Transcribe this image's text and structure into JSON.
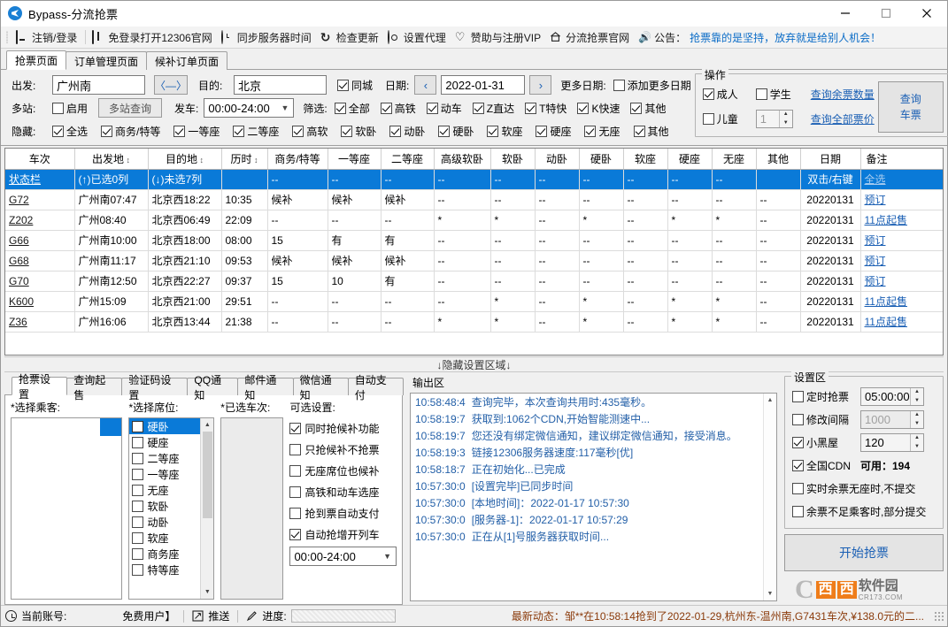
{
  "window": {
    "title": "Bypass-分流抢票",
    "minimize": "—",
    "maximize": "□",
    "close": "✕"
  },
  "toolbar": {
    "items": [
      {
        "icon": "monitor-icon",
        "label": "注销/登录"
      },
      {
        "icon": "window-icon",
        "label": "免登录打开12306官网"
      },
      {
        "icon": "clock-icon",
        "label": "同步服务器时间"
      },
      {
        "icon": "refresh-icon",
        "label": "检查更新"
      },
      {
        "icon": "gear-icon",
        "label": "设置代理"
      },
      {
        "icon": "heart-icon",
        "label": "赞助与注册VIP"
      },
      {
        "icon": "home-icon",
        "label": "分流抢票官网"
      },
      {
        "icon": "speaker-icon",
        "label": "公告："
      }
    ],
    "notice": "抢票靠的是坚持，放弃就是给别人机会！"
  },
  "tabs": [
    {
      "label": "抢票页面",
      "active": true
    },
    {
      "label": "订单管理页面",
      "active": false
    },
    {
      "label": "候补订单页面",
      "active": false
    }
  ],
  "search": {
    "from_label": "出发:",
    "from_value": "广州南",
    "swap_label": "〈—〉",
    "to_label": "目的:",
    "to_value": "北京",
    "same_city_label": "同城",
    "same_city_checked": true,
    "date_label": "日期:",
    "prev_label": "‹",
    "next_label": "›",
    "date_value": "2022-01-31",
    "more_date_label": "更多日期:",
    "add_more_date_label": "添加更多日期",
    "add_more_date_checked": false,
    "multi_label": "多站:",
    "enable_label": "启用",
    "enable_checked": false,
    "multi_query_btn": "多站查询",
    "depart_label": "发车:",
    "depart_value": "00:00-24:00",
    "filter_label": "筛选:",
    "filters": [
      {
        "label": "全部",
        "checked": true
      },
      {
        "label": "高铁",
        "checked": true
      },
      {
        "label": "动车",
        "checked": true
      },
      {
        "label": "Z直达",
        "checked": true
      },
      {
        "label": "T特快",
        "checked": true
      },
      {
        "label": "K快速",
        "checked": true
      },
      {
        "label": "其他",
        "checked": true
      }
    ],
    "hide_label": "隐藏:",
    "hides": [
      {
        "label": "全选",
        "checked": true
      },
      {
        "label": "商务/特等",
        "checked": true
      },
      {
        "label": "一等座",
        "checked": true
      },
      {
        "label": "二等座",
        "checked": true
      },
      {
        "label": "高软",
        "checked": true
      },
      {
        "label": "软卧",
        "checked": true
      },
      {
        "label": "动卧",
        "checked": true
      },
      {
        "label": "硬卧",
        "checked": true
      },
      {
        "label": "软座",
        "checked": true
      },
      {
        "label": "硬座",
        "checked": true
      },
      {
        "label": "无座",
        "checked": true
      },
      {
        "label": "其他",
        "checked": true
      }
    ]
  },
  "operation": {
    "legend": "操作",
    "adult_label": "成人",
    "adult_checked": true,
    "student_label": "学生",
    "student_checked": false,
    "child_label": "儿童",
    "child_checked": false,
    "child_count": "1",
    "query_remain_link": "查询余票数量",
    "query_price_link": "查询全部票价",
    "query_btn_line1": "查询",
    "query_btn_line2": "车票"
  },
  "table": {
    "headers": [
      "车次",
      "出发地",
      "目的地",
      "历时",
      "商务/特等",
      "一等座",
      "二等座",
      "高级软卧",
      "软卧",
      "动卧",
      "硬卧",
      "软座",
      "硬座",
      "无座",
      "其他",
      "日期",
      "备注"
    ],
    "sortable": [
      false,
      true,
      true,
      true,
      false,
      false,
      false,
      false,
      false,
      false,
      false,
      false,
      false,
      false,
      false,
      false,
      false
    ],
    "status_row": {
      "train": "状态栏",
      "from": "(↑)已选0列",
      "to": "(↓)未选7列",
      "duration": "",
      "cells": [
        "--",
        "--",
        "--",
        "--",
        "--",
        "--",
        "--",
        "--",
        "--",
        "--",
        ""
      ],
      "date": "双击/右键",
      "note": "全选"
    },
    "rows": [
      {
        "train": "G72",
        "from": "广州南07:47",
        "to": "北京西18:22",
        "duration": "10:35",
        "cells": [
          "候补",
          "候补",
          "候补",
          "--",
          "--",
          "--",
          "--",
          "--",
          "--",
          "--",
          "--"
        ],
        "date": "20220131",
        "note": "预订"
      },
      {
        "train": "Z202",
        "from": "广州08:40",
        "to": "北京西06:49",
        "duration": "22:09",
        "cells": [
          "--",
          "--",
          "--",
          "*",
          "*",
          "--",
          "*",
          "--",
          "*",
          "*",
          "--"
        ],
        "date": "20220131",
        "note": "11点起售"
      },
      {
        "train": "G66",
        "from": "广州南10:00",
        "to": "北京西18:00",
        "duration": "08:00",
        "cells": [
          "15",
          "有",
          "有",
          "--",
          "--",
          "--",
          "--",
          "--",
          "--",
          "--",
          "--"
        ],
        "date": "20220131",
        "note": "预订"
      },
      {
        "train": "G68",
        "from": "广州南11:17",
        "to": "北京西21:10",
        "duration": "09:53",
        "cells": [
          "候补",
          "候补",
          "候补",
          "--",
          "--",
          "--",
          "--",
          "--",
          "--",
          "--",
          "--"
        ],
        "date": "20220131",
        "note": "预订"
      },
      {
        "train": "G70",
        "from": "广州南12:50",
        "to": "北京西22:27",
        "duration": "09:37",
        "cells": [
          "15",
          "10",
          "有",
          "--",
          "--",
          "--",
          "--",
          "--",
          "--",
          "--",
          "--"
        ],
        "date": "20220131",
        "note": "预订"
      },
      {
        "train": "K600",
        "from": "广州15:09",
        "to": "北京西21:00",
        "duration": "29:51",
        "cells": [
          "--",
          "--",
          "--",
          "--",
          "*",
          "--",
          "*",
          "--",
          "*",
          "*",
          "--"
        ],
        "date": "20220131",
        "note": "11点起售"
      },
      {
        "train": "Z36",
        "from": "广州16:06",
        "to": "北京西13:44",
        "duration": "21:38",
        "cells": [
          "--",
          "--",
          "--",
          "*",
          "*",
          "--",
          "*",
          "--",
          "*",
          "*",
          "--"
        ],
        "date": "20220131",
        "note": "11点起售"
      }
    ]
  },
  "hide_settings_bar": "↓隐藏设置区域↓",
  "subtabs": [
    {
      "label": "抢票设置",
      "active": true
    },
    {
      "label": "查询起售",
      "active": false
    },
    {
      "label": "验证码设置",
      "active": false
    },
    {
      "label": "QQ通知",
      "active": false
    },
    {
      "label": "邮件通知",
      "active": false
    },
    {
      "label": "微信通知",
      "active": false
    },
    {
      "label": "自动支付",
      "active": false
    }
  ],
  "grab_settings": {
    "passenger_label": "*选择乘客:",
    "seat_label": "*选择席位:",
    "train_label": "*已选车次:",
    "optional_label": "可选设置:",
    "passengers": [],
    "seats": [
      {
        "label": "硬卧",
        "checked": false,
        "selected": true
      },
      {
        "label": "硬座",
        "checked": false,
        "selected": false
      },
      {
        "label": "二等座",
        "checked": false,
        "selected": false
      },
      {
        "label": "一等座",
        "checked": false,
        "selected": false
      },
      {
        "label": "无座",
        "checked": false,
        "selected": false
      },
      {
        "label": "软卧",
        "checked": false,
        "selected": false
      },
      {
        "label": "动卧",
        "checked": false,
        "selected": false
      },
      {
        "label": "软座",
        "checked": false,
        "selected": false
      },
      {
        "label": "商务座",
        "checked": false,
        "selected": false
      },
      {
        "label": "特等座",
        "checked": false,
        "selected": false
      }
    ],
    "selected_trains": [],
    "options": [
      {
        "label": "同时抢候补功能",
        "checked": true
      },
      {
        "label": "只抢候补不抢票",
        "checked": false
      },
      {
        "label": "无座席位也候补",
        "checked": false
      },
      {
        "label": "高铁和动车选座",
        "checked": false
      },
      {
        "label": "抢到票自动支付",
        "checked": false
      },
      {
        "label": "自动抢增开列车",
        "checked": true
      }
    ],
    "time_range": "00:00-24:00"
  },
  "output": {
    "legend": "输出区",
    "lines": [
      {
        "time": "10:58:48:4",
        "text": "查询完毕，本次查询共用时:435毫秒。"
      },
      {
        "time": "10:58:19:7",
        "text": "获取到:1062个CDN,开始智能测速中..."
      },
      {
        "time": "10:58:19:7",
        "text": "您还没有绑定微信通知，建议绑定微信通知，接受消息。"
      },
      {
        "time": "10:58:19:3",
        "text": "链接12306服务器速度:117毫秒[优]"
      },
      {
        "time": "10:58:18:7",
        "text": "正在初始化...已完成"
      },
      {
        "time": "10:57:30:0",
        "text": "[设置完毕]已同步时间"
      },
      {
        "time": "10:57:30:0",
        "text": "[本地时间]：2022-01-17 10:57:30"
      },
      {
        "time": "10:57:30:0",
        "text": "[服务器-1]：2022-01-17 10:57:29"
      },
      {
        "time": "10:57:30:0",
        "text": "正在从[1]号服务器获取时间..."
      }
    ]
  },
  "settings_area": {
    "legend": "设置区",
    "timed_grab_label": "定时抢票",
    "timed_grab_checked": false,
    "timed_grab_value": "05:00:00",
    "interval_label": "修改间隔",
    "interval_checked": false,
    "interval_value": "1000",
    "blackroom_label": "小黑屋",
    "blackroom_checked": true,
    "blackroom_value": "120",
    "cdn_label": "全国CDN",
    "cdn_checked": true,
    "cdn_available": "可用：194",
    "no_seat_label": "实时余票无座时,不提交",
    "no_seat_checked": false,
    "partial_label": "余票不足乘客时,部分提交",
    "partial_checked": false,
    "start_button": "开始抢票"
  },
  "statusbar": {
    "account_label": "当前账号:",
    "account_value": "免费用户】",
    "push_label": "推送",
    "progress_label": "进度:",
    "marquee": "最新动态：邹**在10:58:14抢到了2022-01-29,杭州东-温州南,G7431车次,¥138.0元的二..."
  },
  "watermark": {
    "c": "C",
    "b1": "西",
    "b2": "西",
    "txt": "软件园",
    "sub": "CR173.COM"
  }
}
